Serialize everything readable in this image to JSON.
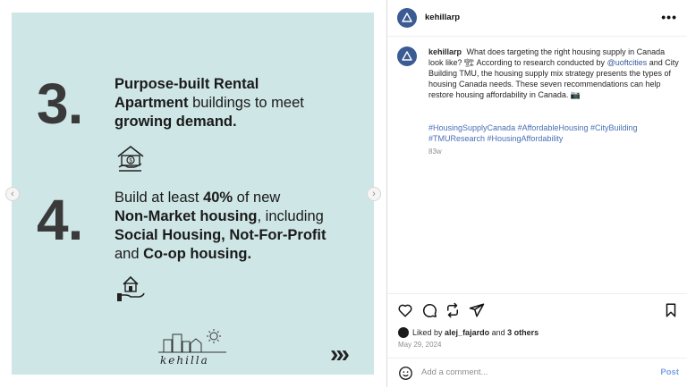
{
  "post": {
    "slide": {
      "items": [
        {
          "number": "3.",
          "lines": [
            {
              "segments": [
                {
                  "t": "Purpose-built Rental",
                  "b": true
                }
              ]
            },
            {
              "segments": [
                {
                  "t": "Apartment",
                  "b": true
                },
                {
                  "t": " buildings to meet",
                  "b": false
                }
              ]
            },
            {
              "segments": [
                {
                  "t": "growing demand.",
                  "b": true
                }
              ]
            }
          ]
        },
        {
          "number": "4.",
          "lines": [
            {
              "segments": [
                {
                  "t": "Build at least ",
                  "b": false
                },
                {
                  "t": "40%",
                  "b": true
                },
                {
                  "t": " of new",
                  "b": false
                }
              ]
            },
            {
              "segments": [
                {
                  "t": "Non-Market housing",
                  "b": true
                },
                {
                  "t": ", including",
                  "b": false
                }
              ]
            },
            {
              "segments": [
                {
                  "t": "Social Housing, Not-For-Profit",
                  "b": true
                }
              ]
            },
            {
              "segments": [
                {
                  "t": "and ",
                  "b": false
                },
                {
                  "t": "Co-op housing.",
                  "b": true
                }
              ]
            }
          ]
        }
      ],
      "brand_logo_text": "kehilla",
      "next_chevrons": "›››",
      "background": "#cfe6e6"
    },
    "nav": {
      "prev": "‹",
      "next": "›"
    },
    "header": {
      "username": "kehillarp",
      "more": "•••"
    },
    "caption": {
      "username": "kehillarp",
      "part1": "What does targeting the right housing supply in Canada look like? 🏗 According to research conducted by",
      "mention": "@uoftcities",
      "part2": "and City Building TMU, the housing supply mix strategy presents the types of housing Canada needs. These seven recommendations can help restore housing affordability in Canada. 📷",
      "hashtags": "#HousingSupplyCanada #AffordableHousing #CityBuilding #TMUResearch #HousingAffordability",
      "time": "83w"
    },
    "likes": {
      "prefix": "Liked by",
      "user": "alej_fajardo",
      "middle": "and",
      "others": "3 others"
    },
    "date": "May 29, 2024",
    "comment": {
      "placeholder": "Add a comment...",
      "post_label": "Post"
    },
    "colors": {
      "accent": "#3b5b93",
      "link": "#4a6fb5",
      "post": "#7ba3e6"
    }
  }
}
